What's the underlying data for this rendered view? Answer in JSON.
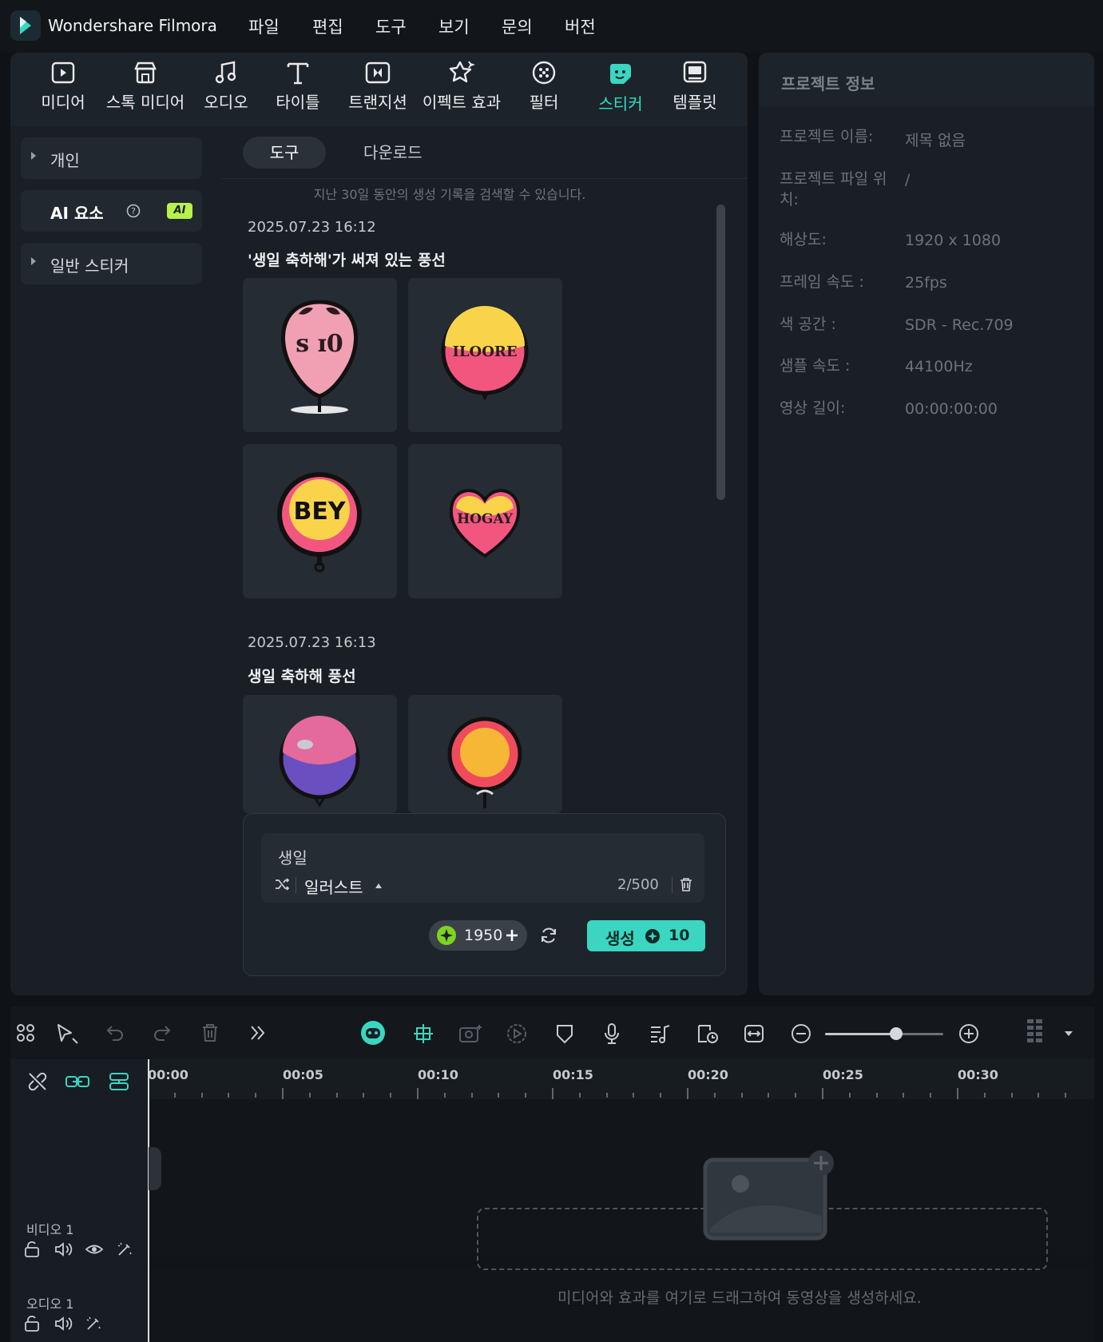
{
  "app": {
    "title": "Wondershare Filmora"
  },
  "menu": [
    "파일",
    "편집",
    "도구",
    "보기",
    "문의",
    "버전"
  ],
  "toolbar": {
    "items": [
      {
        "label": "미디어",
        "icon": "media-icon"
      },
      {
        "label": "스톡 미디어",
        "icon": "stock-media-icon"
      },
      {
        "label": "오디오",
        "icon": "audio-note-icon"
      },
      {
        "label": "타이틀",
        "icon": "title-t-icon"
      },
      {
        "label": "트랜지션",
        "icon": "transition-icon"
      },
      {
        "label": "이펙트 효과",
        "icon": "effects-icon"
      },
      {
        "label": "필터",
        "icon": "filter-icon"
      },
      {
        "label": "스티커",
        "icon": "sticker-icon",
        "active": true
      },
      {
        "label": "템플릿",
        "icon": "template-icon"
      }
    ],
    "accent": "#2fe0c4"
  },
  "sidebar": {
    "personal": "개인",
    "ai_elements": "AI 요소",
    "ai_badge": "AI",
    "general_stickers": "일반 스티커"
  },
  "tabs": {
    "tool": "도구",
    "download": "다운로드"
  },
  "hint": "지난 30일 동안의 생성 기록을 검색할 수 있습니다.",
  "history": [
    {
      "date": "2025.07.23 16:12",
      "prompt": "'생일 축하해'가 써져 있는 풍선",
      "stickers": [
        {
          "text": "ꜱ ɪ0",
          "name": "pink-balloon-sticker"
        },
        {
          "text": "ILOORE",
          "name": "yellow-pink-balloon-sticker"
        },
        {
          "text": "BEY",
          "name": "bey-balloon-sticker"
        },
        {
          "text": "HOGAY",
          "name": "heart-balloon-sticker"
        }
      ]
    },
    {
      "date": "2025.07.23 16:13",
      "prompt": "생일 축하해 풍선",
      "stickers": [
        {
          "text": "",
          "name": "purple-balloon-sticker"
        },
        {
          "text": "",
          "name": "orange-balloon-sticker"
        }
      ]
    }
  ],
  "generator": {
    "prompt_value": "생일",
    "style": "일러스트",
    "char_count": "2/500",
    "credits": "1950",
    "generate_label": "생성",
    "generate_cost": "10"
  },
  "project_info": {
    "title": "프로젝트 정보",
    "rows": [
      {
        "key": "프로젝트 이름:",
        "value": "제목 없음"
      },
      {
        "key": "프로젝트 파일 위치:",
        "value": "/"
      },
      {
        "key": "해상도:",
        "value": "1920 x 1080"
      },
      {
        "key": "프레임 속도 :",
        "value": "25fps"
      },
      {
        "key": "색 공간 :",
        "value": "SDR - Rec.709"
      },
      {
        "key": "샘플 속도 :",
        "value": "44100Hz"
      },
      {
        "key": "영상 길이:",
        "value": "00:00:00:00"
      }
    ]
  },
  "timeline": {
    "ruler": [
      "00:00",
      "00:05",
      "00:10",
      "00:15",
      "00:20",
      "00:25",
      "00:30"
    ],
    "zoom_level": 0.6,
    "tracks": {
      "video": "비디오 1",
      "audio": "오디오 1"
    },
    "drop_hint": "미디어와 효과를 여기로 드래그하여 동영상을 생성하세요."
  }
}
